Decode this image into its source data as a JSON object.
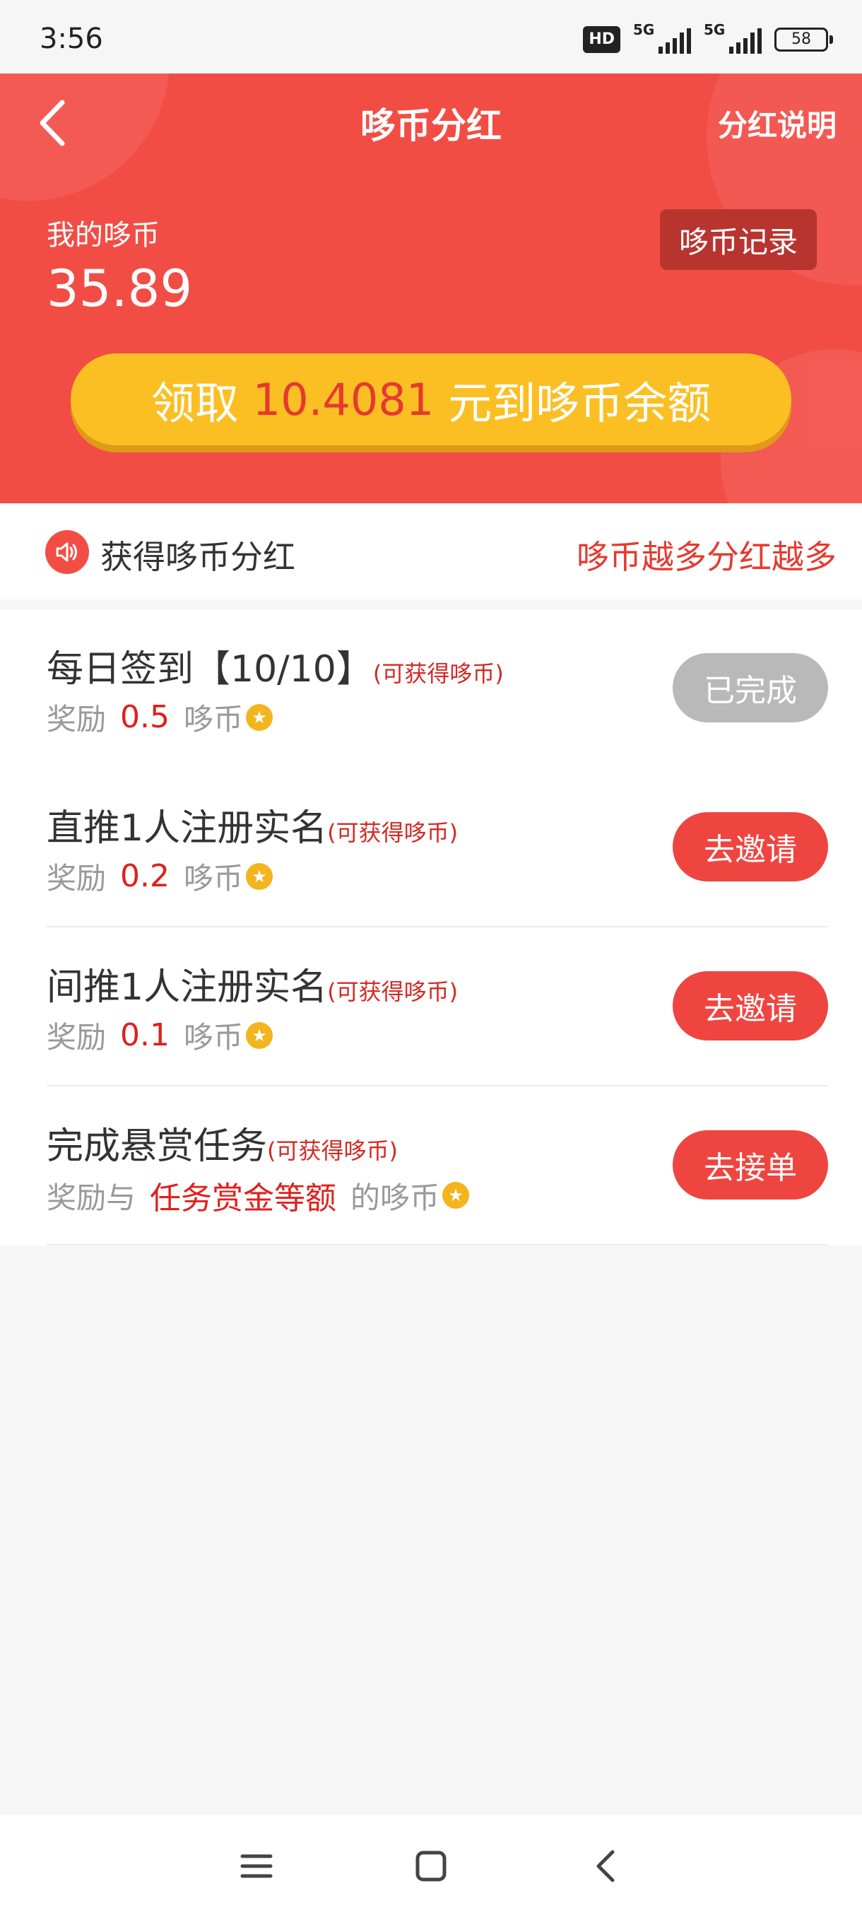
{
  "status_bar": {
    "time": "3:56",
    "hd_label": "HD",
    "network1": "5G",
    "network2": "5G",
    "battery": "58"
  },
  "header": {
    "title": "哆币分红",
    "right_link": "分红说明",
    "my_coins_label": "我的哆币",
    "my_coins_value": "35.89",
    "record_button": "哆币记录",
    "claim": {
      "prefix": "领取",
      "amount": "10.4081",
      "suffix": "元到哆币余额"
    }
  },
  "notice": {
    "text": "获得哆币分红",
    "right_text": "哆币越多分红越多"
  },
  "tasks": [
    {
      "title": "每日签到【10/10】",
      "hint": "(可获得哆币)",
      "reward_prefix": "奖励",
      "reward_value": "0.5",
      "reward_suffix": "哆币",
      "button": "已完成"
    },
    {
      "title": "直推1人注册实名",
      "hint": "(可获得哆币)",
      "reward_prefix": "奖励",
      "reward_value": "0.2",
      "reward_suffix": "哆币",
      "button": "去邀请"
    },
    {
      "title": "间推1人注册实名",
      "hint": "(可获得哆币)",
      "reward_prefix": "奖励",
      "reward_value": "0.1",
      "reward_suffix": "哆币",
      "button": "去邀请"
    },
    {
      "title": "完成悬赏任务",
      "hint": "(可获得哆币)",
      "reward_prefix": "奖励与",
      "reward_value": "任务赏金等额",
      "reward_suffix": "的哆币",
      "button": "去接单"
    }
  ],
  "colors": {
    "brand_red": "#f24d45",
    "gold": "#fbbf24",
    "done_gray": "#b9b9b9"
  }
}
